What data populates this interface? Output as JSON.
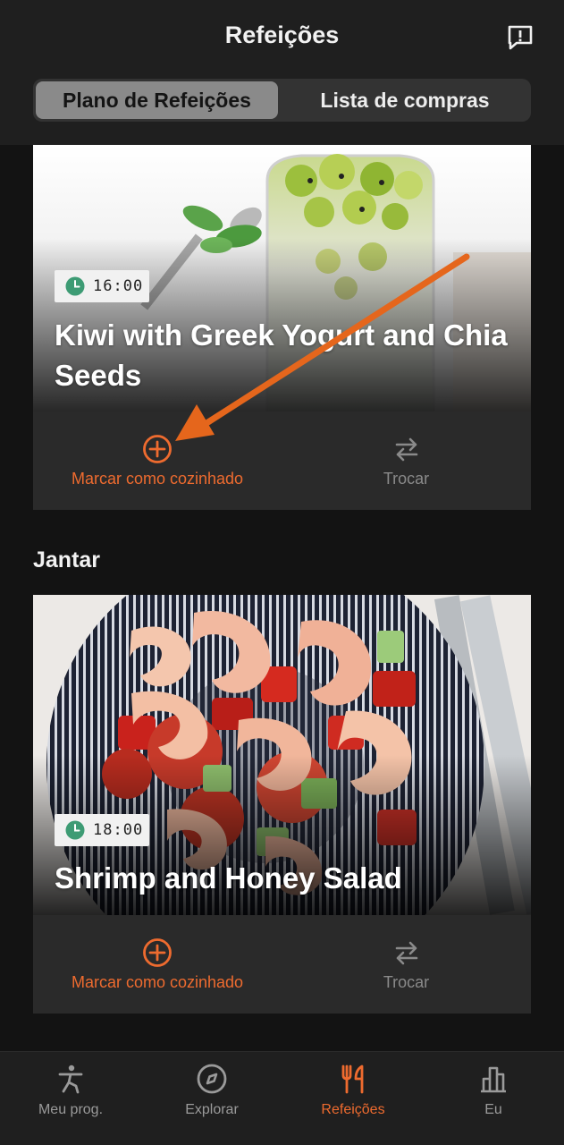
{
  "header": {
    "title": "Refeições",
    "tabs": [
      {
        "label": "Plano de Refeições",
        "active": true
      },
      {
        "label": "Lista de compras",
        "active": false
      }
    ]
  },
  "meals": [
    {
      "time": "16:00",
      "name": "Kiwi with Greek Yogurt and Chia Seeds",
      "cook_label": "Marcar como cozinhado",
      "swap_label": "Trocar"
    },
    {
      "section": "Jantar",
      "time": "18:00",
      "name": "Shrimp and Honey Salad",
      "cook_label": "Marcar como cozinhado",
      "swap_label": "Trocar"
    }
  ],
  "bottom_nav": [
    {
      "label": "Meu prog.",
      "icon": "exercise-icon",
      "active": false
    },
    {
      "label": "Explorar",
      "icon": "compass-icon",
      "active": false
    },
    {
      "label": "Refeições",
      "icon": "fork-knife-icon",
      "active": true
    },
    {
      "label": "Eu",
      "icon": "chart-icon",
      "active": false
    }
  ],
  "colors": {
    "accent": "#ee6b2f",
    "background": "#131313",
    "surface": "#2a2a2a",
    "clock": "#3d9b74"
  }
}
